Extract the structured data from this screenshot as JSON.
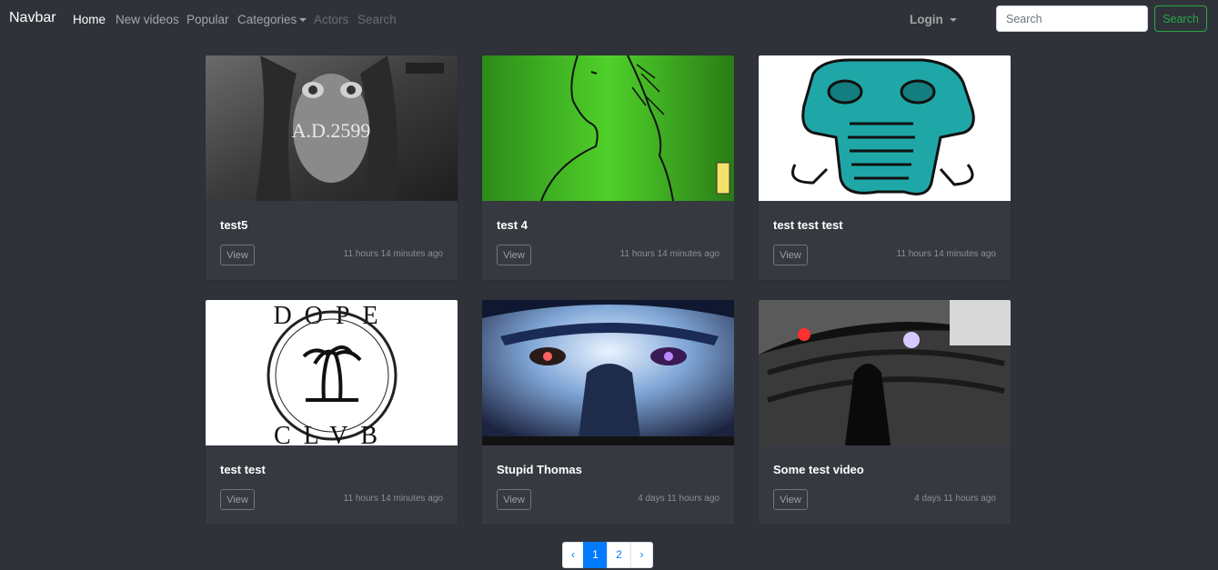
{
  "navbar": {
    "brand": "Navbar",
    "links": [
      {
        "label": "Home"
      },
      {
        "label": "New videos"
      },
      {
        "label": "Popular"
      },
      {
        "label": "Categories"
      },
      {
        "label": "Actors"
      },
      {
        "label": "Search"
      }
    ],
    "login_label": "Login",
    "search_placeholder": "Search",
    "search_button": "Search"
  },
  "colors": {
    "background": "#2f3339",
    "card": "#363a40",
    "success": "#28a745",
    "primary": "#007bff"
  },
  "videos": [
    {
      "title": "test5",
      "view_label": "View",
      "time": "11 hours 14 minutes ago",
      "thumb_text": "A.D.2599"
    },
    {
      "title": "test 4",
      "view_label": "View",
      "time": "11 hours 14 minutes ago"
    },
    {
      "title": "test test test",
      "view_label": "View",
      "time": "11 hours 14 minutes ago"
    },
    {
      "title": "test test",
      "view_label": "View",
      "time": "11 hours 14 minutes ago",
      "thumb_text_top": "DOPE",
      "thumb_text_bottom": "CLVB"
    },
    {
      "title": "Stupid Thomas",
      "view_label": "View",
      "time": "4 days 11 hours ago"
    },
    {
      "title": "Some test video",
      "view_label": "View",
      "time": "4 days 11 hours ago"
    }
  ],
  "pagination": {
    "prev": "‹",
    "pages": [
      "1",
      "2"
    ],
    "current": "1",
    "next": "›"
  }
}
